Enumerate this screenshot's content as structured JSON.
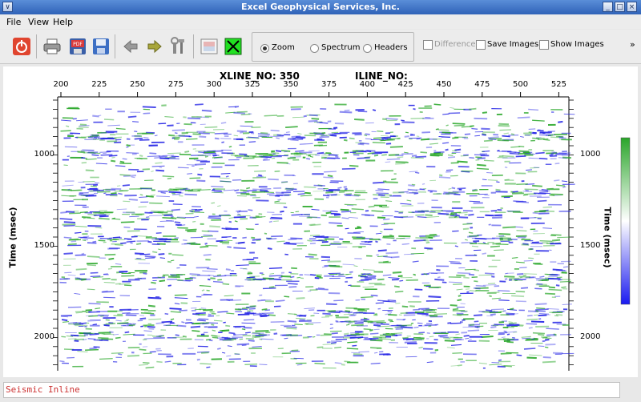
{
  "window": {
    "title": "Excel Geophysical Services, Inc."
  },
  "menu": {
    "file": "File",
    "view": "View",
    "help": "Help"
  },
  "toolbar": {
    "icons": [
      "power-icon",
      "print-icon",
      "pdf-icon",
      "save-icon",
      "back-arrow-icon",
      "forward-arrow-icon",
      "tools-icon",
      "image-icon",
      "close-x-icon"
    ],
    "radio": {
      "zoom": "Zoom",
      "spectrum": "Spectrum",
      "headers": "Headers",
      "selected": "Zoom"
    },
    "checks": {
      "difference": "Difference",
      "save_images": "Save Images",
      "show_images": "Show Images"
    },
    "overflow": "»"
  },
  "plot": {
    "xline_label": "XLINE_NO: 350",
    "iline_label": "ILINE_NO:",
    "top_ticks": [
      "200",
      "225",
      "250",
      "275",
      "300",
      "325",
      "350",
      "375",
      "400",
      "425",
      "450",
      "475",
      "500",
      "525"
    ],
    "y_ticks": [
      "1000",
      "1500",
      "2000"
    ],
    "y_title": "Time (msec)",
    "colorbar": {
      "top": "#2aa52a",
      "mid": "#ffffff",
      "bottom": "#1a1af0"
    }
  },
  "status": {
    "text": "Seismic Inline"
  }
}
